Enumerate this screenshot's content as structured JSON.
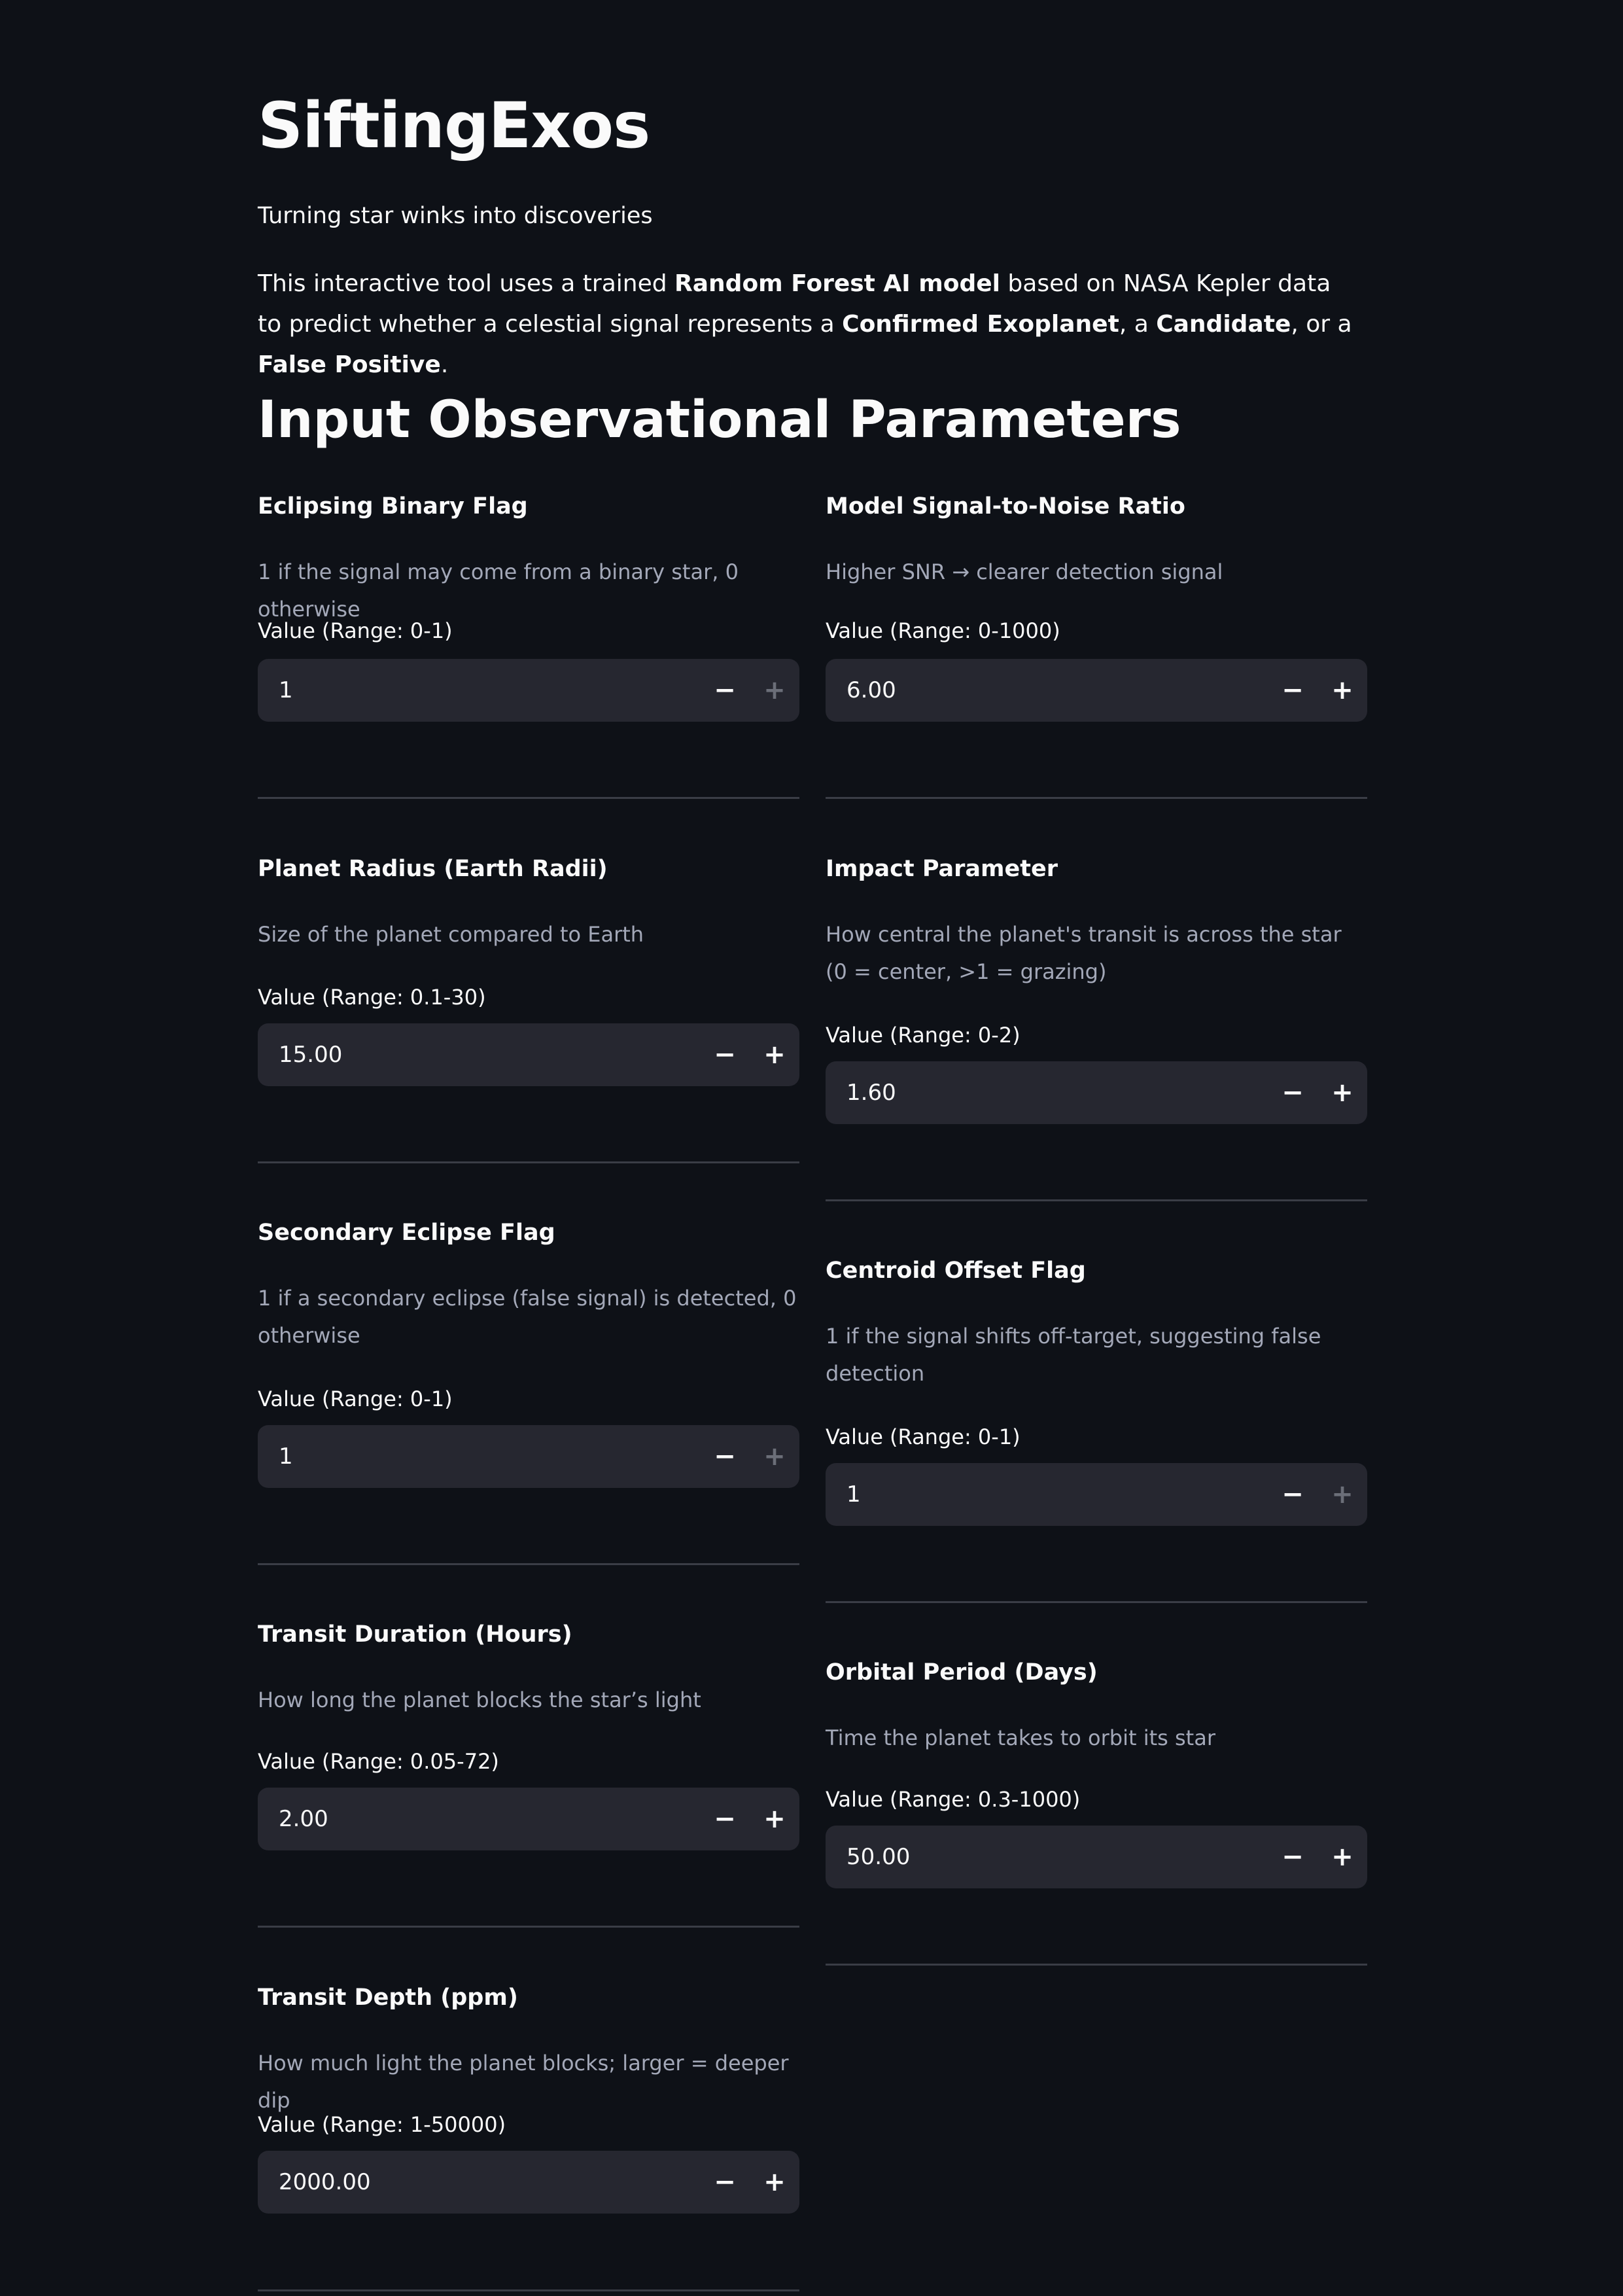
{
  "app": {
    "title": "SiftingExos",
    "tagline": "Turning star winks into discoveries",
    "intro": {
      "line1_pre": "This interactive tool uses a trained ",
      "line1_bold": "Random Forest AI model",
      "line1_post": " based on NASA Kepler data",
      "line2_pre": "to predict whether a celestial signal represents a ",
      "line2_bold1": "Confirmed Exoplanet",
      "line2_mid1": ", a ",
      "line2_bold2": "Candidate",
      "line2_mid2": ", or a ",
      "line2_bold3": "False Positive",
      "line2_end": "."
    }
  },
  "section_title": "Input Observational Parameters",
  "stepper": {
    "minus_symbol": "−",
    "plus_symbol": "+"
  },
  "fields": {
    "eclipsing_binary": {
      "title": "Eclipsing Binary Flag",
      "description": "1 if the signal may come from a binary star, 0 otherwise",
      "label": "Value (Range: 0-1)",
      "value": "1"
    },
    "snr": {
      "title": "Model Signal-to-Noise Ratio",
      "description": "Higher SNR → clearer detection signal",
      "label": "Value (Range: 0-1000)",
      "value": "6.00"
    },
    "planet_radius": {
      "title": "Planet Radius (Earth Radii)",
      "description": "Size of the planet compared to Earth",
      "label": "Value (Range: 0.1-30)",
      "value": "15.00"
    },
    "impact_parameter": {
      "title": "Impact Parameter",
      "description": "How central the planet's transit is across the star (0 = center, >1 = grazing)",
      "label": "Value (Range: 0-2)",
      "value": "1.60"
    },
    "secondary_eclipse": {
      "title": "Secondary Eclipse Flag",
      "description": "1 if a secondary eclipse (false signal) is detected, 0 otherwise",
      "label": "Value (Range: 0-1)",
      "value": "1"
    },
    "centroid_offset": {
      "title": "Centroid Offset Flag",
      "description": "1 if the signal shifts off-target, suggesting false detection",
      "label": "Value (Range: 0-1)",
      "value": "1"
    },
    "transit_duration": {
      "title": "Transit Duration (Hours)",
      "description": "How long the planet blocks the star’s light",
      "label": "Value (Range: 0.05-72)",
      "value": "2.00"
    },
    "orbital_period": {
      "title": "Orbital Period (Days)",
      "description": "Time the planet takes to orbit its star",
      "label": "Value (Range: 0.3-1000)",
      "value": "50.00"
    },
    "transit_depth": {
      "title": "Transit Depth (ppm)",
      "description": "How much light the planet blocks; larger = deeper dip",
      "label": "Value (Range: 1-50000)",
      "value": "2000.00"
    }
  }
}
